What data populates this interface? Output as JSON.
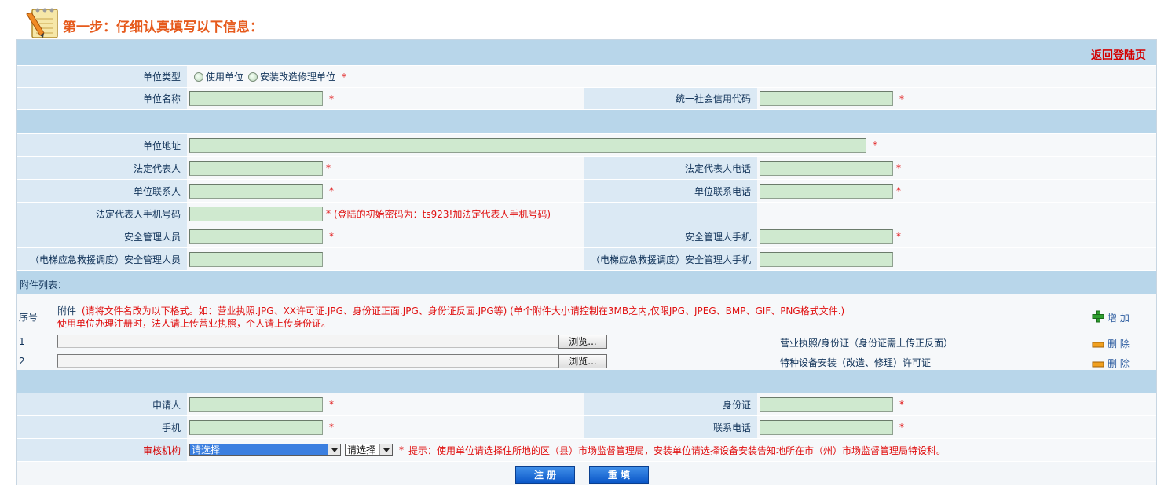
{
  "header": {
    "title": "第一步：仔细认真填写以下信息："
  },
  "back_link": "返回登陆页",
  "required_mark": "*",
  "unit_type": {
    "label": "单位类型",
    "options": [
      "使用单位",
      "安装改造修理单位"
    ]
  },
  "fields": {
    "unit_name": "单位名称",
    "credit_code": "统一社会信用代码",
    "address": "单位地址",
    "legal_rep": "法定代表人",
    "legal_rep_phone": "法定代表人电话",
    "contact": "单位联系人",
    "contact_phone": "单位联系电话",
    "legal_rep_mobile": "法定代表人手机号码",
    "safety_manager": "安全管理人员",
    "safety_manager_mobile": "安全管理人手机",
    "elevator_safety_manager": "（电梯应急救援调度）安全管理人员",
    "elevator_safety_manager_mobile": "（电梯应急救援调度）安全管理人手机"
  },
  "password_hint": "(登陆的初始密码为：ts923!加法定代表人手机号码)",
  "attachments": {
    "title": "附件列表：",
    "seq_header": "序号",
    "file_header": "附件",
    "note_line1": "(请将文件名改为以下格式。如：营业执照.JPG、XX许可证.JPG、身份证正面.JPG、身份证反面.JPG等) (单个附件大小请控制在3MB之内,仅限JPG、JPEG、BMP、GIF、PNG格式文件.)",
    "note_line2": "使用单位办理注册时，法人请上传营业执照，个人请上传身份证。",
    "add_label": "增 加",
    "browse_label": "浏览...",
    "delete_label": "删 除",
    "rows": [
      {
        "seq": "1",
        "desc": "营业执照/身份证（身份证需上传正反面）"
      },
      {
        "seq": "2",
        "desc": "特种设备安装（改造、修理）许可证"
      }
    ]
  },
  "applicant": {
    "name": "申请人",
    "id": "身份证",
    "mobile": "手机",
    "phone": "联系电话"
  },
  "review": {
    "label": "审核机构",
    "select1": "请选择",
    "select2": "请选择",
    "tip": "提示：使用单位请选择住所地的区（县）市场监督管理局，安装单位请选择设备安装告知地所在市（州）市场监督管理局特设科。"
  },
  "buttons": {
    "register": "注 册",
    "reset": "重 填"
  },
  "colors": {
    "band": "#b8d6ea",
    "label_bg": "#dbe9f4",
    "input_bg": "#cfe9cf",
    "accent": "#e65a1c",
    "required": "#e01010",
    "button": "#0b57c8"
  }
}
